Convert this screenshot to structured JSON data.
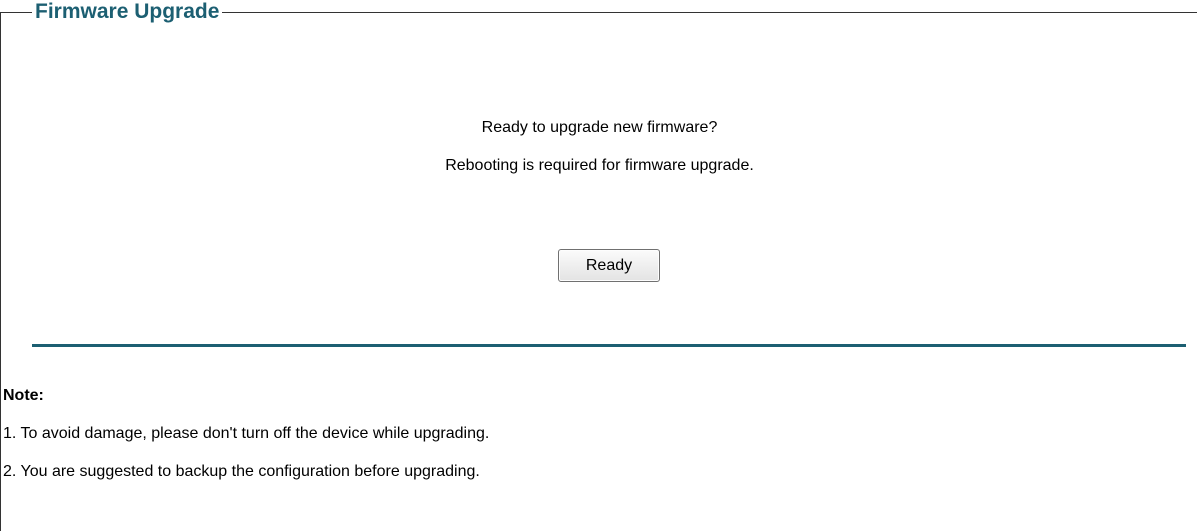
{
  "panel": {
    "title": "Firmware Upgrade"
  },
  "message": {
    "line1": "Ready to upgrade new firmware?",
    "line2": "Rebooting is required for firmware upgrade."
  },
  "actions": {
    "ready_label": "Ready"
  },
  "note": {
    "heading": "Note:",
    "items": [
      "1. To avoid damage, please don't turn off the device while upgrading.",
      "2. You are suggested to backup the configuration before upgrading."
    ]
  },
  "colors": {
    "accent": "#1c5f72",
    "text": "#000000",
    "background": "#ffffff"
  }
}
